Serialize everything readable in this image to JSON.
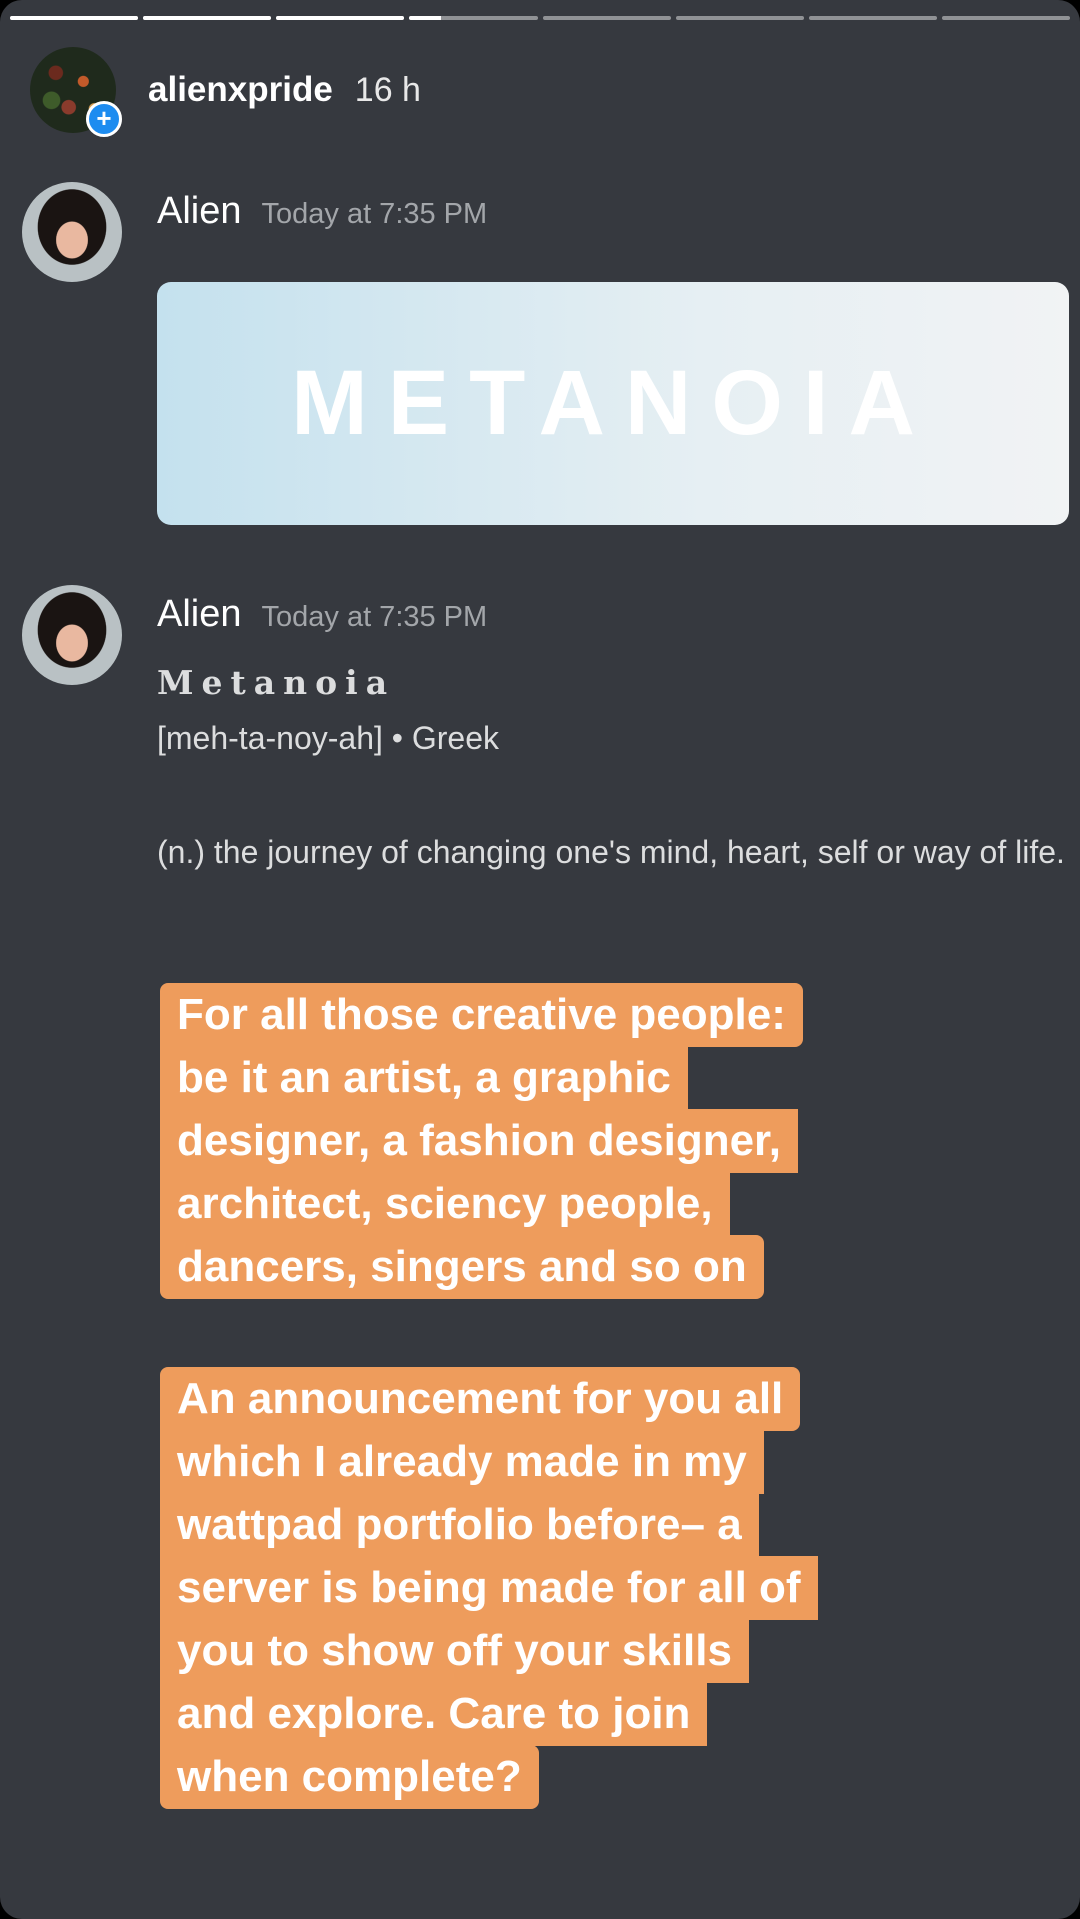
{
  "progress": {
    "segments": 8,
    "complete": 3,
    "current_fraction": 0.25
  },
  "story": {
    "username": "alienxpride",
    "time": "16 h",
    "add_glyph": "+"
  },
  "message1": {
    "author": "Alien",
    "timestamp": "Today at 7:35 PM",
    "banner_text": "METANOIA"
  },
  "message2": {
    "author": "Alien",
    "timestamp": "Today at 7:35 PM",
    "title": "Metanoia",
    "pronunciation": "[meh-ta-noy-ah] • Greek",
    "definition": "(n.) the journey of changing one's mind, heart, self or way of life."
  },
  "stickers": {
    "first": [
      "For all those creative people:",
      "be it an artist, a graphic",
      "designer, a fashion designer,",
      "architect, sciency people,",
      "dancers, singers and so on"
    ],
    "second": [
      "An announcement for you all",
      "which I already made in my",
      "wattpad portfolio before– a",
      "server is being made for all of",
      "you to show off your skills",
      "and explore. Care to join",
      "when complete?"
    ]
  },
  "colors": {
    "background": "#36393f",
    "sticker": "#ee9c5c",
    "badge": "#1d8cf0"
  }
}
